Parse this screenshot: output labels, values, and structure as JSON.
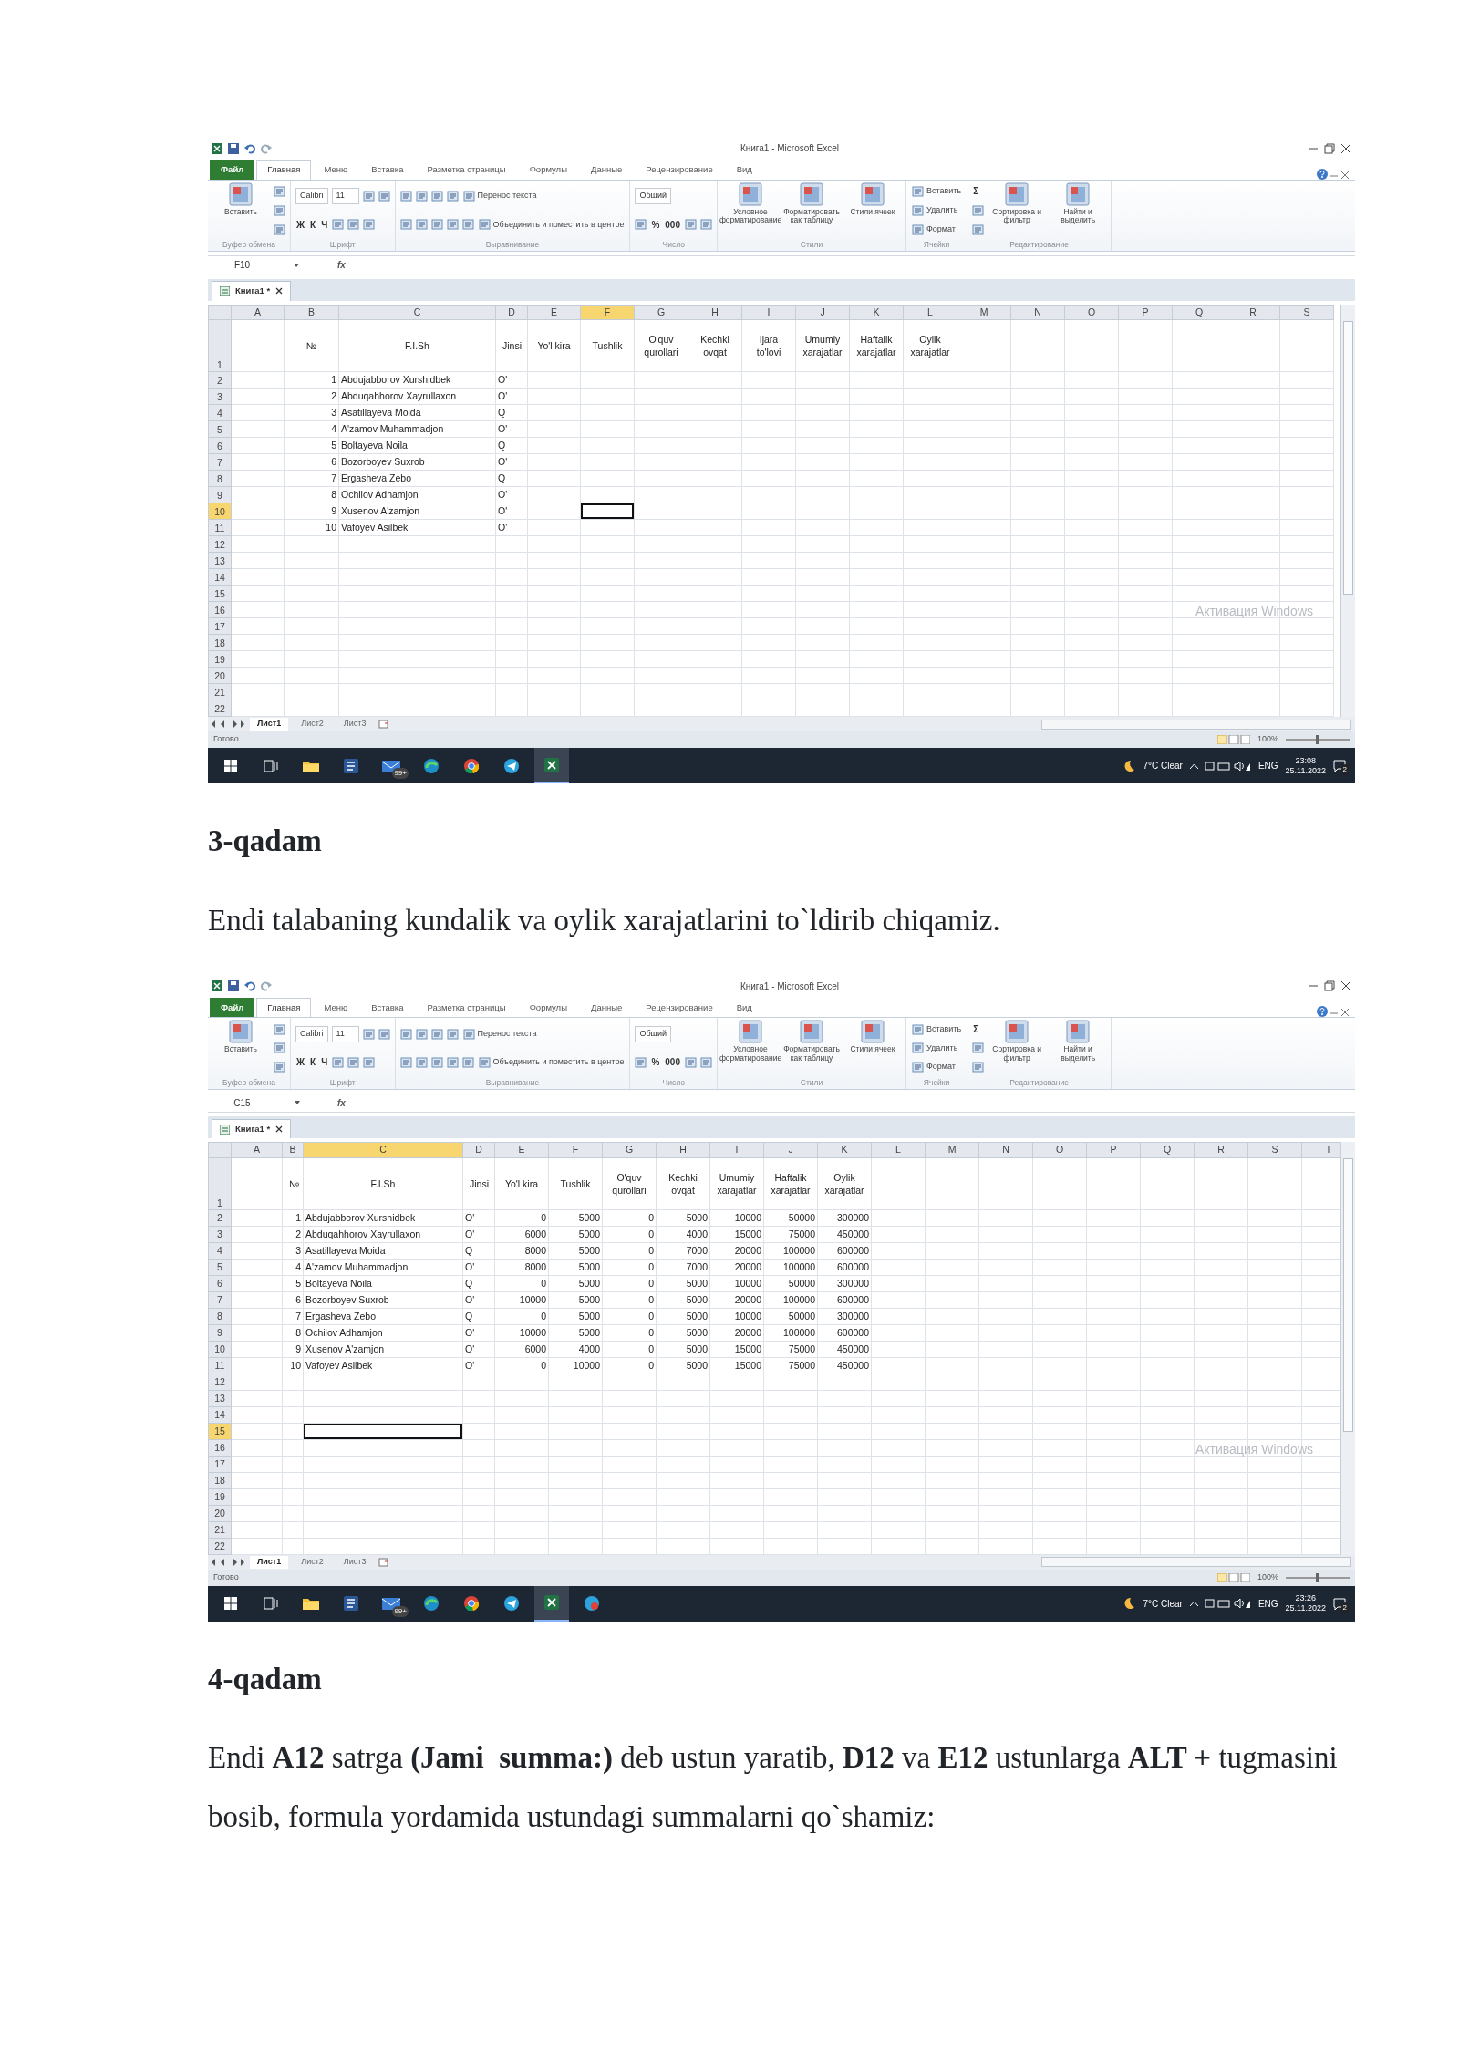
{
  "blocks": [
    {
      "kind": "screenshot",
      "title": "Книга1 - Microsoft Excel",
      "tabs": [
        {
          "kind": "file",
          "label": "Файл",
          "selected": false
        },
        {
          "kind": "tab",
          "label": "Главная",
          "selected": true
        },
        {
          "kind": "tab",
          "label": "Меню",
          "selected": false
        },
        {
          "kind": "tab",
          "label": "Вставка",
          "selected": false
        },
        {
          "kind": "tab",
          "label": "Разметка страницы",
          "selected": false
        },
        {
          "kind": "tab",
          "label": "Формулы",
          "selected": false
        },
        {
          "kind": "tab",
          "label": "Данные",
          "selected": false
        },
        {
          "kind": "tab",
          "label": "Рецензирование",
          "selected": false
        },
        {
          "kind": "tab",
          "label": "Вид",
          "selected": false
        }
      ],
      "ribbon": [
        {
          "label": "Буфер обмена",
          "items": [
            {
              "kind": "large",
              "text": "Вставить"
            },
            {
              "kind": "stack",
              "rows": [
                {
                  "items": [
                    {
                      "kind": "icon"
                    }
                  ]
                },
                {
                  "items": [
                    {
                      "kind": "icon"
                    }
                  ]
                },
                {
                  "items": [
                    {
                      "kind": "icon"
                    }
                  ]
                }
              ]
            }
          ]
        },
        {
          "label": "Шрифт",
          "items": [
            {
              "kind": "stack",
              "rows": [
                {
                  "items": [
                    {
                      "kind": "field",
                      "text": "Calibri"
                    },
                    {
                      "kind": "field",
                      "text": "11"
                    },
                    {
                      "kind": "icon"
                    },
                    {
                      "kind": "icon"
                    }
                  ]
                },
                {
                  "items": [
                    {
                      "kind": "glyph",
                      "text": "Ж"
                    },
                    {
                      "kind": "glyph",
                      "text": "К"
                    },
                    {
                      "kind": "glyph",
                      "text": "Ч"
                    },
                    {
                      "kind": "icon"
                    },
                    {
                      "kind": "icon"
                    },
                    {
                      "kind": "icon"
                    }
                  ]
                }
              ]
            }
          ]
        },
        {
          "label": "Выравнивание",
          "items": [
            {
              "kind": "stack",
              "rows": [
                {
                  "items": [
                    {
                      "kind": "icon"
                    },
                    {
                      "kind": "icon"
                    },
                    {
                      "kind": "icon"
                    },
                    {
                      "kind": "icon"
                    },
                    {
                      "kind": "small",
                      "text": "Перенос текста"
                    }
                  ]
                },
                {
                  "items": [
                    {
                      "kind": "icon"
                    },
                    {
                      "kind": "icon"
                    },
                    {
                      "kind": "icon"
                    },
                    {
                      "kind": "icon"
                    },
                    {
                      "kind": "icon"
                    },
                    {
                      "kind": "small",
                      "text": "Объединить и поместить в центре"
                    }
                  ]
                }
              ]
            }
          ]
        },
        {
          "label": "Число",
          "items": [
            {
              "kind": "stack",
              "rows": [
                {
                  "items": [
                    {
                      "kind": "field",
                      "text": "Общий"
                    }
                  ]
                },
                {
                  "items": [
                    {
                      "kind": "icon"
                    },
                    {
                      "kind": "glyph",
                      "text": "%"
                    },
                    {
                      "kind": "glyph",
                      "text": "000"
                    },
                    {
                      "kind": "icon"
                    },
                    {
                      "kind": "icon"
                    }
                  ]
                }
              ]
            }
          ]
        },
        {
          "label": "Стили",
          "items": [
            {
              "kind": "large",
              "text": "Условное форматирование"
            },
            {
              "kind": "large",
              "text": "Форматировать как таблицу"
            },
            {
              "kind": "large",
              "text": "Стили ячеек"
            }
          ]
        },
        {
          "label": "Ячейки",
          "items": [
            {
              "kind": "stack",
              "rows": [
                {
                  "items": [
                    {
                      "kind": "small",
                      "text": "Вставить"
                    }
                  ]
                },
                {
                  "items": [
                    {
                      "kind": "small",
                      "text": "Удалить"
                    }
                  ]
                },
                {
                  "items": [
                    {
                      "kind": "small",
                      "text": "Формат"
                    }
                  ]
                }
              ]
            }
          ]
        },
        {
          "label": "Редактирование",
          "items": [
            {
              "kind": "stack",
              "rows": [
                {
                  "items": [
                    {
                      "kind": "glyph",
                      "text": "Σ"
                    }
                  ]
                },
                {
                  "items": [
                    {
                      "kind": "icon"
                    }
                  ]
                },
                {
                  "items": [
                    {
                      "kind": "icon"
                    }
                  ]
                }
              ]
            },
            {
              "kind": "large",
              "text": "Сортировка и фильтр"
            },
            {
              "kind": "large",
              "text": "Найти и выделить"
            }
          ]
        }
      ],
      "name_box": "F10",
      "formula_label": "fx",
      "workbook_tab": "Книга1 *",
      "columns": [
        {
          "label": "A",
          "selected": false
        },
        {
          "label": "B",
          "selected": false
        },
        {
          "label": "C",
          "selected": false
        },
        {
          "label": "D",
          "selected": false
        },
        {
          "label": "E",
          "selected": false
        },
        {
          "label": "F",
          "selected": true
        },
        {
          "label": "G",
          "selected": false
        },
        {
          "label": "H",
          "selected": false
        },
        {
          "label": "I",
          "selected": false
        },
        {
          "label": "J",
          "selected": false
        },
        {
          "label": "K",
          "selected": false
        },
        {
          "label": "L",
          "selected": false
        },
        {
          "label": "M",
          "selected": false
        },
        {
          "label": "N",
          "selected": false
        },
        {
          "label": "O",
          "selected": false
        },
        {
          "label": "P",
          "selected": false
        },
        {
          "label": "Q",
          "selected": false
        },
        {
          "label": "R",
          "selected": false
        },
        {
          "label": "S",
          "selected": false
        }
      ],
      "rows": [
        {
          "number": "1",
          "selected": false,
          "cells": [
            null,
            "№",
            "F.I.Sh",
            "Jinsi",
            "Yo'l kira",
            "Tushlik",
            "O'quv qurollari",
            "Kechki ovqat",
            "Ijara to'lovi",
            "Umumiy xarajatlar",
            "Haftalik xarajatlar",
            "Oylik xarajatlar"
          ]
        },
        {
          "number": "2",
          "selected": false,
          "cells": [
            null,
            "1",
            "Abdujabborov Xurshidbek",
            "O'"
          ]
        },
        {
          "number": "3",
          "selected": false,
          "cells": [
            null,
            "2",
            "Abduqahhorov Xayrullaxon",
            "O'"
          ]
        },
        {
          "number": "4",
          "selected": false,
          "cells": [
            null,
            "3",
            "Asatillayeva Moida",
            "Q"
          ]
        },
        {
          "number": "5",
          "selected": false,
          "cells": [
            null,
            "4",
            "A'zamov Muhammadjon",
            "O'"
          ]
        },
        {
          "number": "6",
          "selected": false,
          "cells": [
            null,
            "5",
            "Boltayeva Noila",
            "Q"
          ]
        },
        {
          "number": "7",
          "selected": false,
          "cells": [
            null,
            "6",
            "Bozorboyev Suxrob",
            "O'"
          ]
        },
        {
          "number": "8",
          "selected": false,
          "cells": [
            null,
            "7",
            "Ergasheva Zebo",
            "Q"
          ]
        },
        {
          "number": "9",
          "selected": false,
          "cells": [
            null,
            "8",
            "Ochilov Adhamjon",
            "O'"
          ]
        },
        {
          "number": "10",
          "selected": true,
          "cells": [
            null,
            "9",
            "Xusenov A'zamjon",
            "O'"
          ]
        },
        {
          "number": "11",
          "selected": false,
          "cells": [
            null,
            "10",
            "Vafoyev Asilbek",
            "O'"
          ]
        },
        {
          "number": "12",
          "selected": false
        },
        {
          "number": "13",
          "selected": false
        },
        {
          "number": "14",
          "selected": false
        },
        {
          "number": "15",
          "selected": false
        },
        {
          "number": "16",
          "selected": false
        },
        {
          "number": "17",
          "selected": false
        },
        {
          "number": "18",
          "selected": false
        },
        {
          "number": "19",
          "selected": false
        },
        {
          "number": "20",
          "selected": false
        },
        {
          "number": "21",
          "selected": false
        },
        {
          "number": "22",
          "selected": false
        }
      ],
      "sheets": [
        {
          "label": "Лист1",
          "selected": true
        },
        {
          "label": "Лист2",
          "selected": false
        },
        {
          "label": "Лист3",
          "selected": false
        }
      ],
      "status": "Готово",
      "zoom": "100%",
      "zoom_slider": {
        "level": 0.5
      },
      "watermark": "Активация Windows",
      "taskbar": {
        "apps": [
          {
            "kind": "start",
            "selected": false
          },
          {
            "kind": "taskview",
            "selected": false
          },
          {
            "kind": "explorer",
            "selected": false
          },
          {
            "kind": "word",
            "selected": false
          },
          {
            "kind": "mail",
            "selected": false
          },
          {
            "kind": "edge",
            "selected": false
          },
          {
            "kind": "chrome",
            "selected": false
          },
          {
            "kind": "telegram",
            "selected": false
          },
          {
            "kind": "excel",
            "selected": true
          }
        ],
        "mail_badge": "99+",
        "weather": "7°C Clear",
        "language": "ENG",
        "time": "23:08",
        "date": "25.11.2022",
        "notifications": "2"
      }
    },
    {
      "kind": "heading",
      "text": "3-qadam"
    },
    {
      "kind": "paragraph",
      "text": "Endi talabaning kundalik va oylik xarajatlarini to`ldirib chiqamiz."
    },
    {
      "kind": "screenshot",
      "title": "Книга1 - Microsoft Excel",
      "tabs": [
        {
          "kind": "file",
          "label": "Файл",
          "selected": false
        },
        {
          "kind": "tab",
          "label": "Главная",
          "selected": true
        },
        {
          "kind": "tab",
          "label": "Меню",
          "selected": false
        },
        {
          "kind": "tab",
          "label": "Вставка",
          "selected": false
        },
        {
          "kind": "tab",
          "label": "Разметка страницы",
          "selected": false
        },
        {
          "kind": "tab",
          "label": "Формулы",
          "selected": false
        },
        {
          "kind": "tab",
          "label": "Данные",
          "selected": false
        },
        {
          "kind": "tab",
          "label": "Рецензирование",
          "selected": false
        },
        {
          "kind": "tab",
          "label": "Вид",
          "selected": false
        }
      ],
      "ribbon": [
        {
          "label": "Буфер обмена",
          "items": [
            {
              "kind": "large",
              "text": "Вставить"
            },
            {
              "kind": "stack",
              "rows": [
                {
                  "items": [
                    {
                      "kind": "icon"
                    }
                  ]
                },
                {
                  "items": [
                    {
                      "kind": "icon"
                    }
                  ]
                },
                {
                  "items": [
                    {
                      "kind": "icon"
                    }
                  ]
                }
              ]
            }
          ]
        },
        {
          "label": "Шрифт",
          "items": [
            {
              "kind": "stack",
              "rows": [
                {
                  "items": [
                    {
                      "kind": "field",
                      "text": "Calibri"
                    },
                    {
                      "kind": "field",
                      "text": "11"
                    },
                    {
                      "kind": "icon"
                    },
                    {
                      "kind": "icon"
                    }
                  ]
                },
                {
                  "items": [
                    {
                      "kind": "glyph",
                      "text": "Ж"
                    },
                    {
                      "kind": "glyph",
                      "text": "К"
                    },
                    {
                      "kind": "glyph",
                      "text": "Ч"
                    },
                    {
                      "kind": "icon"
                    },
                    {
                      "kind": "icon"
                    },
                    {
                      "kind": "icon"
                    }
                  ]
                }
              ]
            }
          ]
        },
        {
          "label": "Выравнивание",
          "items": [
            {
              "kind": "stack",
              "rows": [
                {
                  "items": [
                    {
                      "kind": "icon"
                    },
                    {
                      "kind": "icon"
                    },
                    {
                      "kind": "icon"
                    },
                    {
                      "kind": "icon"
                    },
                    {
                      "kind": "small",
                      "text": "Перенос текста"
                    }
                  ]
                },
                {
                  "items": [
                    {
                      "kind": "icon"
                    },
                    {
                      "kind": "icon"
                    },
                    {
                      "kind": "icon"
                    },
                    {
                      "kind": "icon"
                    },
                    {
                      "kind": "icon"
                    },
                    {
                      "kind": "small",
                      "text": "Объединить и поместить в центре"
                    }
                  ]
                }
              ]
            }
          ]
        },
        {
          "label": "Число",
          "items": [
            {
              "kind": "stack",
              "rows": [
                {
                  "items": [
                    {
                      "kind": "field",
                      "text": "Общий"
                    }
                  ]
                },
                {
                  "items": [
                    {
                      "kind": "icon"
                    },
                    {
                      "kind": "glyph",
                      "text": "%"
                    },
                    {
                      "kind": "glyph",
                      "text": "000"
                    },
                    {
                      "kind": "icon"
                    },
                    {
                      "kind": "icon"
                    }
                  ]
                }
              ]
            }
          ]
        },
        {
          "label": "Стили",
          "items": [
            {
              "kind": "large",
              "text": "Условное форматирование"
            },
            {
              "kind": "large",
              "text": "Форматировать как таблицу"
            },
            {
              "kind": "large",
              "text": "Стили ячеек"
            }
          ]
        },
        {
          "label": "Ячейки",
          "items": [
            {
              "kind": "stack",
              "rows": [
                {
                  "items": [
                    {
                      "kind": "small",
                      "text": "Вставить"
                    }
                  ]
                },
                {
                  "items": [
                    {
                      "kind": "small",
                      "text": "Удалить"
                    }
                  ]
                },
                {
                  "items": [
                    {
                      "kind": "small",
                      "text": "Формат"
                    }
                  ]
                }
              ]
            }
          ]
        },
        {
          "label": "Редактирование",
          "items": [
            {
              "kind": "stack",
              "rows": [
                {
                  "items": [
                    {
                      "kind": "glyph",
                      "text": "Σ"
                    }
                  ]
                },
                {
                  "items": [
                    {
                      "kind": "icon"
                    }
                  ]
                },
                {
                  "items": [
                    {
                      "kind": "icon"
                    }
                  ]
                }
              ]
            },
            {
              "kind": "large",
              "text": "Сортировка и фильтр"
            },
            {
              "kind": "large",
              "text": "Найти и выделить"
            }
          ]
        }
      ],
      "name_box": "C15",
      "formula_label": "fx",
      "workbook_tab": "Книга1 *",
      "columns": [
        {
          "label": "A",
          "selected": false
        },
        {
          "label": "B",
          "selected": false
        },
        {
          "label": "C",
          "selected": true
        },
        {
          "label": "D",
          "selected": false
        },
        {
          "label": "E",
          "selected": false
        },
        {
          "label": "F",
          "selected": false
        },
        {
          "label": "G",
          "selected": false
        },
        {
          "label": "H",
          "selected": false
        },
        {
          "label": "I",
          "selected": false
        },
        {
          "label": "J",
          "selected": false
        },
        {
          "label": "K",
          "selected": false
        },
        {
          "label": "L",
          "selected": false
        },
        {
          "label": "M",
          "selected": false
        },
        {
          "label": "N",
          "selected": false
        },
        {
          "label": "O",
          "selected": false
        },
        {
          "label": "P",
          "selected": false
        },
        {
          "label": "Q",
          "selected": false
        },
        {
          "label": "R",
          "selected": false
        },
        {
          "label": "S",
          "selected": false
        },
        {
          "label": "T",
          "selected": false
        }
      ],
      "rows": [
        {
          "number": "1",
          "selected": false,
          "cells": [
            null,
            "№",
            "F.I.Sh",
            "Jinsi",
            "Yo'l kira",
            "Tushlik",
            "O'quv qurollari",
            "Kechki ovqat",
            "Umumiy xarajatlar",
            "Haftalik xarajatlar",
            "Oylik xarajatlar"
          ]
        },
        {
          "number": "2",
          "selected": false,
          "cells": [
            null,
            "1",
            "Abdujabborov Xurshidbek",
            "O'",
            "0",
            "5000",
            "0",
            "5000",
            "10000",
            "50000",
            "300000"
          ]
        },
        {
          "number": "3",
          "selected": false,
          "cells": [
            null,
            "2",
            "Abduqahhorov Xayrullaxon",
            "O'",
            "6000",
            "5000",
            "0",
            "4000",
            "15000",
            "75000",
            "450000"
          ]
        },
        {
          "number": "4",
          "selected": false,
          "cells": [
            null,
            "3",
            "Asatillayeva Moida",
            "Q",
            "8000",
            "5000",
            "0",
            "7000",
            "20000",
            "100000",
            "600000"
          ]
        },
        {
          "number": "5",
          "selected": false,
          "cells": [
            null,
            "4",
            "A'zamov Muhammadjon",
            "O'",
            "8000",
            "5000",
            "0",
            "7000",
            "20000",
            "100000",
            "600000"
          ]
        },
        {
          "number": "6",
          "selected": false,
          "cells": [
            null,
            "5",
            "Boltayeva Noila",
            "Q",
            "0",
            "5000",
            "0",
            "5000",
            "10000",
            "50000",
            "300000"
          ]
        },
        {
          "number": "7",
          "selected": false,
          "cells": [
            null,
            "6",
            "Bozorboyev Suxrob",
            "O'",
            "10000",
            "5000",
            "0",
            "5000",
            "20000",
            "100000",
            "600000"
          ]
        },
        {
          "number": "8",
          "selected": false,
          "cells": [
            null,
            "7",
            "Ergasheva Zebo",
            "Q",
            "0",
            "5000",
            "0",
            "5000",
            "10000",
            "50000",
            "300000"
          ]
        },
        {
          "number": "9",
          "selected": false,
          "cells": [
            null,
            "8",
            "Ochilov Adhamjon",
            "O'",
            "10000",
            "5000",
            "0",
            "5000",
            "20000",
            "100000",
            "600000"
          ]
        },
        {
          "number": "10",
          "selected": false,
          "cells": [
            null,
            "9",
            "Xusenov A'zamjon",
            "O'",
            "6000",
            "4000",
            "0",
            "5000",
            "15000",
            "75000",
            "450000"
          ]
        },
        {
          "number": "11",
          "selected": false,
          "cells": [
            null,
            "10",
            "Vafoyev Asilbek",
            "O'",
            "0",
            "10000",
            "0",
            "5000",
            "15000",
            "75000",
            "450000"
          ]
        },
        {
          "number": "12",
          "selected": false
        },
        {
          "number": "13",
          "selected": false
        },
        {
          "number": "14",
          "selected": false
        },
        {
          "number": "15",
          "selected": true
        },
        {
          "number": "16",
          "selected": false
        },
        {
          "number": "17",
          "selected": false
        },
        {
          "number": "18",
          "selected": false
        },
        {
          "number": "19",
          "selected": false
        },
        {
          "number": "20",
          "selected": false
        },
        {
          "number": "21",
          "selected": false
        },
        {
          "number": "22",
          "selected": false
        }
      ],
      "sheets": [
        {
          "label": "Лист1",
          "selected": true
        },
        {
          "label": "Лист2",
          "selected": false
        },
        {
          "label": "Лист3",
          "selected": false
        }
      ],
      "status": "Готово",
      "zoom": "100%",
      "zoom_slider": {
        "level": 0.5
      },
      "watermark": "Активация Windows",
      "taskbar": {
        "apps": [
          {
            "kind": "start",
            "selected": false
          },
          {
            "kind": "taskview",
            "selected": false
          },
          {
            "kind": "explorer",
            "selected": false
          },
          {
            "kind": "word",
            "selected": false
          },
          {
            "kind": "mail",
            "selected": false
          },
          {
            "kind": "edge",
            "selected": false
          },
          {
            "kind": "chrome",
            "selected": false
          },
          {
            "kind": "telegram",
            "selected": false
          },
          {
            "kind": "excel",
            "selected": true
          },
          {
            "kind": "other",
            "selected": false
          }
        ],
        "mail_badge": "99+",
        "weather": "7°C Clear",
        "language": "ENG",
        "time": "23:26",
        "date": "25.11.2022",
        "notifications": "2"
      }
    },
    {
      "kind": "heading",
      "text": "4-qadam"
    },
    {
      "kind": "paragraph",
      "text": "Endi **A12** satrga **(Jami  summa:)** deb ustun yaratib, **D12** va **E12** ustunlarga **ALT +** tugmasini bosib, formula yordamida ustundagi summalarni qo`shamiz:"
    }
  ]
}
